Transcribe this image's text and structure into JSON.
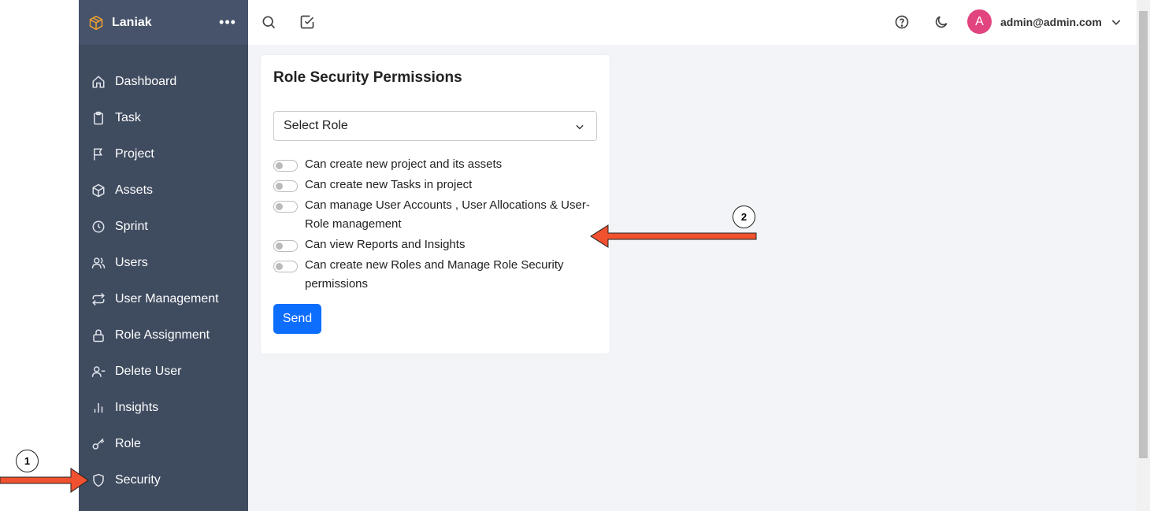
{
  "app": {
    "brand": "Laniak",
    "more_icon": "more-horizontal-icon"
  },
  "sidebar": {
    "items": [
      {
        "label": "Dashboard",
        "icon": "home-icon"
      },
      {
        "label": "Task",
        "icon": "clipboard-icon"
      },
      {
        "label": "Project",
        "icon": "flag-icon"
      },
      {
        "label": "Assets",
        "icon": "box-icon"
      },
      {
        "label": "Sprint",
        "icon": "clock-icon"
      },
      {
        "label": "Users",
        "icon": "users-icon"
      },
      {
        "label": "User Management",
        "icon": "repeat-icon"
      },
      {
        "label": "Role Assignment",
        "icon": "lock-icon"
      },
      {
        "label": "Delete User",
        "icon": "user-minus-icon"
      },
      {
        "label": "Insights",
        "icon": "bar-chart-icon"
      },
      {
        "label": "Role",
        "icon": "key-icon"
      },
      {
        "label": "Security",
        "icon": "shield-icon"
      }
    ]
  },
  "topbar": {
    "user_initial": "A",
    "user_email": "admin@admin.com",
    "avatar_color": "#e2447f"
  },
  "card": {
    "title": "Role Security Permissions",
    "select": {
      "value": "Select Role"
    },
    "permissions": [
      "Can create new project and its assets",
      "Can create new Tasks in project",
      "Can manage User Accounts , User Allocations & User-Role management",
      "Can view Reports and Insights",
      "Can create new Roles and Manage Role Security permissions"
    ],
    "send_label": "Send"
  },
  "annotations": {
    "step1": "1",
    "step2": "2",
    "arrow_color": "#f0512f"
  },
  "colors": {
    "sidebar_bg": "#3f4b5f",
    "primary": "#0d6efd"
  }
}
